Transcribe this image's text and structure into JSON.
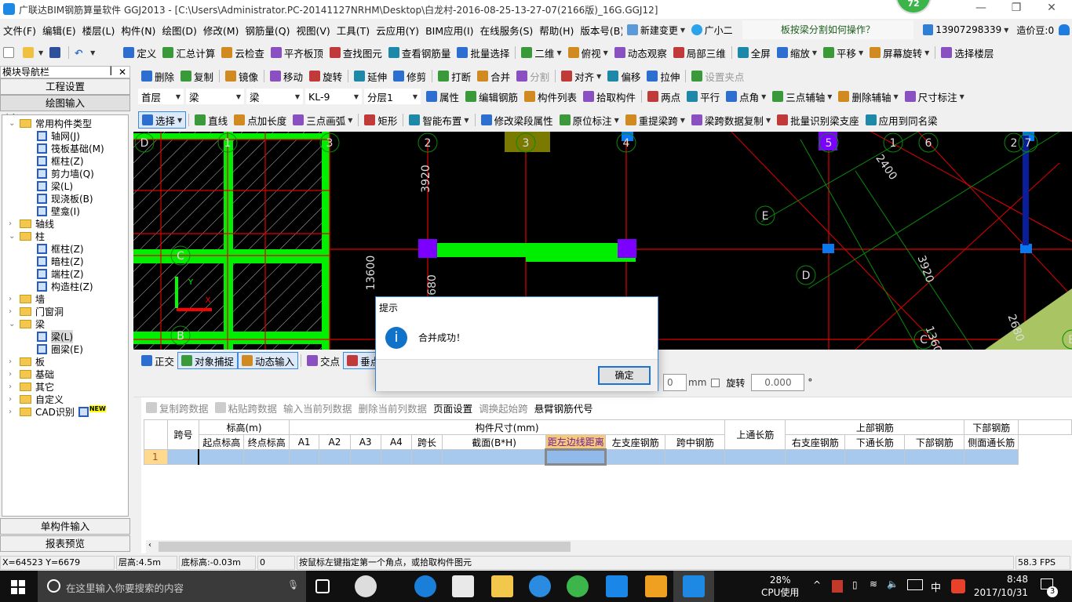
{
  "window": {
    "title": "广联达BIM钢筋算量软件 GGJ2013 - [C:\\Users\\Administrator.PC-20141127NRHM\\Desktop\\白龙村-2016-08-25-13-27-07(2166版)_16G.GGJ12]",
    "badge": "72"
  },
  "menu": [
    "文件(F)",
    "编辑(E)",
    "楼层(L)",
    "构件(N)",
    "绘图(D)",
    "修改(M)",
    "钢筋量(Q)",
    "视图(V)",
    "工具(T)",
    "云应用(Y)",
    "BIM应用(I)",
    "在线服务(S)",
    "帮助(H)",
    "版本号(B)"
  ],
  "menu_right": {
    "new_change": "新建变更",
    "assistant": "广小二",
    "help_tip": "板按梁分割如何操作？",
    "account": "13907298339",
    "beans": "造价豆:0"
  },
  "toolbar1": [
    "定义",
    "汇总计算",
    "云检查",
    "平齐板顶",
    "查找图元",
    "查看钢筋量",
    "批量选择",
    "二维",
    "俯视",
    "动态观察",
    "局部三维",
    "全屏",
    "缩放",
    "平移",
    "屏幕旋转",
    "选择楼层"
  ],
  "toolbar2": [
    "删除",
    "复制",
    "镜像",
    "移动",
    "旋转",
    "延伸",
    "修剪",
    "打断",
    "合并",
    "分割",
    "对齐",
    "偏移",
    "拉伸",
    "设置夹点"
  ],
  "toolbar3": {
    "combos": [
      "首层",
      "梁",
      "梁",
      "KL-9",
      "分层1"
    ],
    "items": [
      "属性",
      "编辑钢筋",
      "构件列表",
      "拾取构件",
      "两点",
      "平行",
      "点角",
      "三点辅轴",
      "删除辅轴",
      "尺寸标注"
    ]
  },
  "toolbar4": [
    "选择",
    "直线",
    "点加长度",
    "三点画弧",
    "矩形",
    "智能布置",
    "修改梁段属性",
    "原位标注",
    "重提梁跨",
    "梁跨数据复制",
    "批量识别梁支座",
    "应用到同名梁"
  ],
  "sidebar": {
    "title": "模块导航栏",
    "buttons": [
      "工程设置",
      "绘图输入"
    ],
    "bottom": [
      "单构件输入",
      "报表预览"
    ],
    "tree": [
      {
        "label": "常用构件类型",
        "type": "folder",
        "open": true
      },
      {
        "label": "轴网(J)",
        "type": "item"
      },
      {
        "label": "筏板基础(M)",
        "type": "item"
      },
      {
        "label": "框柱(Z)",
        "type": "item"
      },
      {
        "label": "剪力墙(Q)",
        "type": "item"
      },
      {
        "label": "梁(L)",
        "type": "item"
      },
      {
        "label": "现浇板(B)",
        "type": "item"
      },
      {
        "label": "壁龛(I)",
        "type": "item"
      },
      {
        "label": "轴线",
        "type": "folder"
      },
      {
        "label": "柱",
        "type": "folder",
        "open": true
      },
      {
        "label": "框柱(Z)",
        "type": "item"
      },
      {
        "label": "暗柱(Z)",
        "type": "item"
      },
      {
        "label": "端柱(Z)",
        "type": "item"
      },
      {
        "label": "构造柱(Z)",
        "type": "item"
      },
      {
        "label": "墙",
        "type": "folder"
      },
      {
        "label": "门窗洞",
        "type": "folder"
      },
      {
        "label": "梁",
        "type": "folder",
        "open": true
      },
      {
        "label": "梁(L)",
        "type": "item",
        "selected": true
      },
      {
        "label": "圈梁(E)",
        "type": "item"
      },
      {
        "label": "板",
        "type": "folder"
      },
      {
        "label": "基础",
        "type": "folder"
      },
      {
        "label": "其它",
        "type": "folder"
      },
      {
        "label": "自定义",
        "type": "folder"
      },
      {
        "label": "CAD识别",
        "type": "folder",
        "badge": "NEW"
      }
    ]
  },
  "canvas": {
    "labels": [
      "D",
      "1",
      "3",
      "2",
      "3",
      "4",
      "5",
      "1",
      "6",
      "2",
      "7",
      "E",
      "D",
      "C",
      "B",
      "C",
      "B",
      "3920",
      "13600",
      "2680",
      "2400",
      "3920",
      "1360",
      "2680",
      "Y",
      "X"
    ]
  },
  "snapbar": [
    "正交",
    "对象捕捉",
    "动态输入",
    "交点",
    "垂点"
  ],
  "offset": {
    "value": "0",
    "unit": "mm",
    "rotate_label": "旋转",
    "rotate_value": "0.000",
    "degree": "°"
  },
  "dialog": {
    "title": "提示",
    "message": "合并成功！",
    "ok": "确定"
  },
  "table_toolbar": [
    "复制跨数据",
    "粘贴跨数据",
    "输入当前列数据",
    "删除当前列数据",
    "页面设置",
    "调换起始跨",
    "悬臂钢筋代号"
  ],
  "table": {
    "group_headers": [
      "跨号",
      "标高(m)",
      "构件尺寸(mm)",
      "上通长筋",
      "上部钢筋",
      "下部钢筋"
    ],
    "sub_headers": [
      "起点标高",
      "终点标高",
      "A1",
      "A2",
      "A3",
      "A4",
      "跨长",
      "截面(B*H)",
      "距左边线距离",
      "左支座钢筋",
      "跨中钢筋",
      "右支座钢筋",
      "下通长筋",
      "下部钢筋",
      "侧面通长筋"
    ],
    "rows": [
      {
        "index": "1"
      }
    ]
  },
  "status": {
    "coords": "X=64523 Y=6679",
    "floor_height": "层高:4.5m",
    "base_height": "底标高:-0.03m",
    "value": "0",
    "hint": "按鼠标左键指定第一个角点，或拾取构件图元",
    "fps": "58.3 FPS"
  },
  "taskbar": {
    "search_placeholder": "在这里输入你要搜索的内容",
    "cpu": "28%",
    "cpu_label": "CPU使用",
    "ime": "中",
    "time": "8:48",
    "date": "2017/10/31",
    "notifications": "3"
  }
}
